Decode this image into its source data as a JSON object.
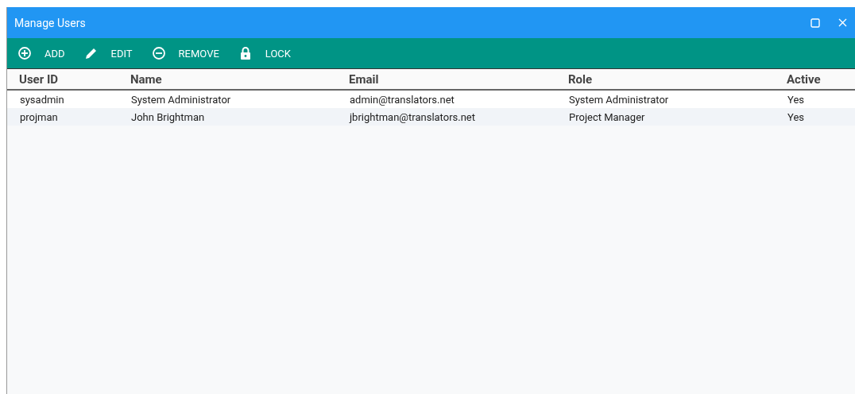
{
  "window": {
    "title": "Manage Users"
  },
  "toolbar": [
    {
      "kind": "add",
      "label": "ADD"
    },
    {
      "kind": "edit",
      "label": "EDIT"
    },
    {
      "kind": "remove",
      "label": "REMOVE"
    },
    {
      "kind": "lock",
      "label": "LOCK"
    }
  ],
  "table": {
    "columns": [
      "User ID",
      "Name",
      "Email",
      "Role",
      "Active"
    ],
    "rows": [
      [
        "sysadmin",
        "System Administrator",
        "admin@translators.net",
        "System Administrator",
        "Yes"
      ],
      [
        "projman",
        "John Brightman",
        "jbrightman@translators.net",
        "Project Manager",
        "Yes"
      ]
    ]
  }
}
